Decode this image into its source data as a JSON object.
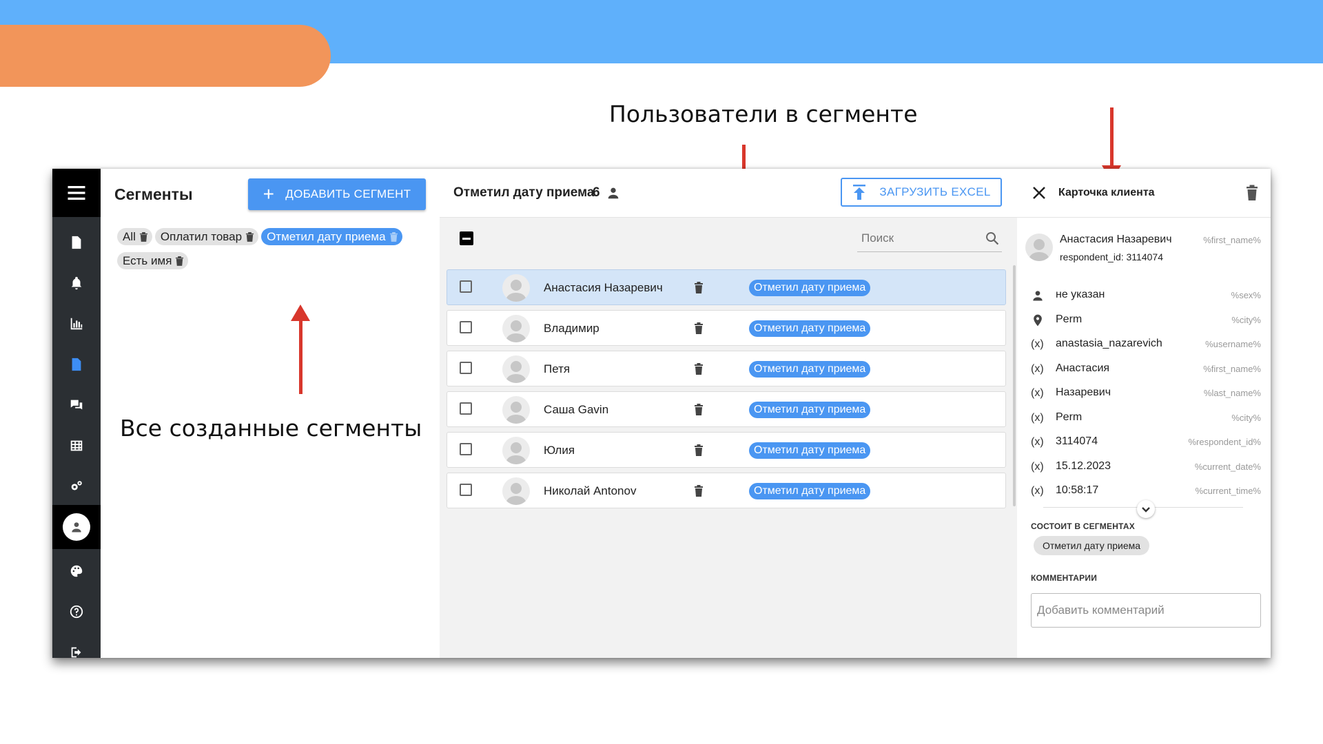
{
  "slide": {
    "caption_users": "Пользователи в сегменте",
    "caption_segments": "Все созданные сегменты"
  },
  "segments": {
    "title": "Сегменты",
    "add_button": "ДОБАВИТЬ СЕГМЕНТ",
    "chips": [
      {
        "label": "All"
      },
      {
        "label": "Оплатил товар"
      },
      {
        "label": "Отметил дату приема",
        "active": true
      },
      {
        "label": "Есть имя"
      }
    ]
  },
  "users": {
    "title": "Отметил дату приема",
    "count": "6",
    "excel_button": "ЗАГРУЗИТЬ EXCEL",
    "search_placeholder": "Поиск",
    "rows": [
      {
        "name": "Анастасия Назаревич",
        "tag": "Отметил дату приема",
        "selected": true
      },
      {
        "name": "Владимир",
        "tag": "Отметил дату приема"
      },
      {
        "name": "Петя",
        "tag": "Отметил дату приема"
      },
      {
        "name": "Саша Gavin",
        "tag": "Отметил дату приема"
      },
      {
        "name": "Юлия",
        "tag": "Отметил дату приема"
      },
      {
        "name": "Николай Antonov",
        "tag": "Отметил дату приема"
      }
    ]
  },
  "card": {
    "title": "Карточка клиента",
    "name": "Анастасия Назаревич",
    "name_var": "%first_name%",
    "respondent": "respondent_id: 3114074",
    "attributes": [
      {
        "icon": "person-icon",
        "value": "не указан",
        "var": "%sex%"
      },
      {
        "icon": "location-pin-icon",
        "value": "Perm",
        "var": "%city%"
      },
      {
        "icon": "(x)",
        "value": "anastasia_nazarevich",
        "var": "%username%"
      },
      {
        "icon": "(x)",
        "value": "Анастасия",
        "var": "%first_name%"
      },
      {
        "icon": "(x)",
        "value": "Назаревич",
        "var": "%last_name%"
      },
      {
        "icon": "(x)",
        "value": "Perm",
        "var": "%city%"
      },
      {
        "icon": "(x)",
        "value": "3114074",
        "var": "%respondent_id%"
      },
      {
        "icon": "(x)",
        "value": "15.12.2023",
        "var": "%current_date%"
      },
      {
        "icon": "(x)",
        "value": "10:58:17",
        "var": "%current_time%"
      }
    ],
    "segments_label": "СОСТОИТ В СЕГМЕНТАХ",
    "segment_chip": "Отметил дату приема",
    "comments_label": "КОММЕНТАРИИ",
    "comment_placeholder": "Добавить комментарий"
  },
  "colors": {
    "header_blue": "#5fb0fb",
    "accent_orange": "#f2955a",
    "primary": "#4a96f2",
    "arrow_red": "#d8372c",
    "sidebar": "#2b2f33"
  }
}
